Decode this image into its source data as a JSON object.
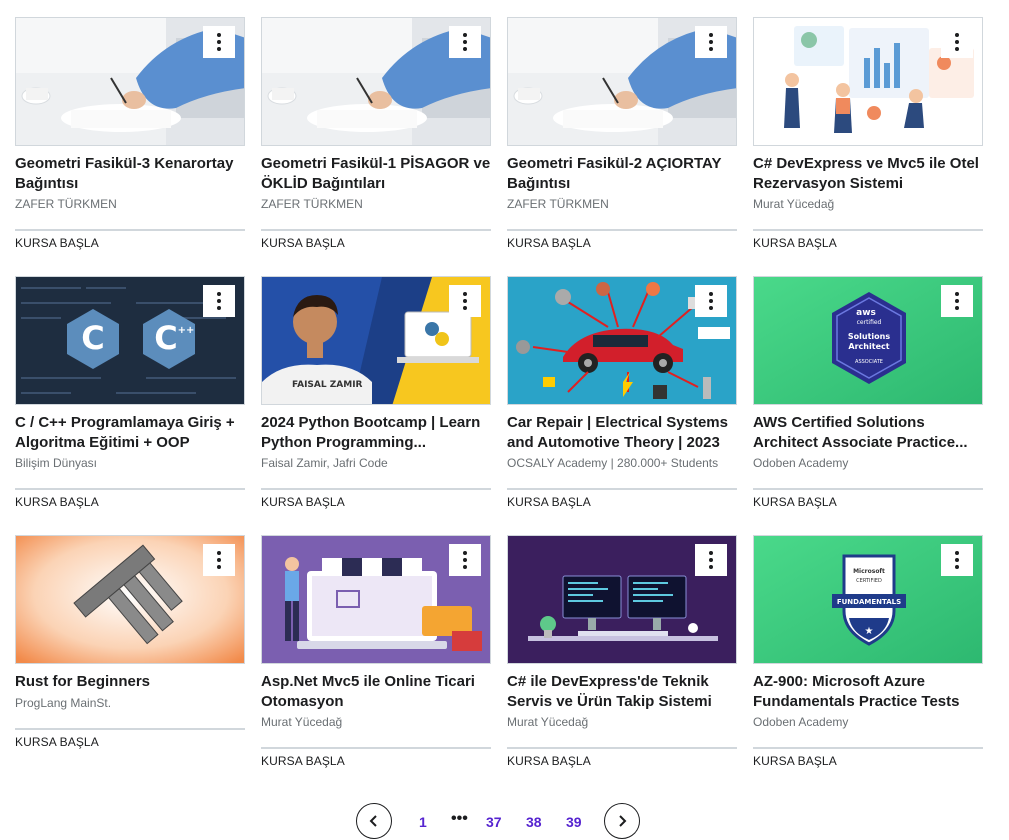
{
  "courses": [
    {
      "title": "Geometri Fasikül-3 Kenarortay Bağıntısı",
      "author": "ZAFER TÜRKMEN",
      "cta": "KURSA BAŞLA",
      "image": "desk-writing-photo"
    },
    {
      "title": "Geometri Fasikül-1 PİSAGOR ve ÖKLİD Bağıntıları",
      "author": "ZAFER TÜRKMEN",
      "cta": "KURSA BAŞLA",
      "image": "desk-writing-photo"
    },
    {
      "title": "Geometri Fasikül-2 AÇIORTAY Bağıntısı",
      "author": "ZAFER TÜRKMEN",
      "cta": "KURSA BAŞLA",
      "image": "desk-writing-photo"
    },
    {
      "title": "C# DevExpress ve Mvc5 ile Otel Rezervasyon Sistemi",
      "author": "Murat Yücedağ",
      "cta": "KURSA BAŞLA",
      "image": "analytics-illustration"
    },
    {
      "title": "C / C++ Programlamaya Giriş + Algoritma Eğitimi + OOP",
      "author": "Bilişim Dünyası",
      "cta": "KURSA BAŞLA",
      "image": "c-cpp-logos"
    },
    {
      "title": "2024 Python Bootcamp | Learn Python Programming...",
      "author": "Faisal Zamir, Jafri Code",
      "cta": "KURSA BAŞLA",
      "image": "python-instructor"
    },
    {
      "title": "Car Repair | Electrical Systems and Automotive Theory | 2023",
      "author": "OCSALY Academy | 280.000+ Students",
      "cta": "KURSA BAŞLA",
      "image": "car-parts-illustration"
    },
    {
      "title": "AWS Certified Solutions Architect Associate Practice...",
      "author": "Odoben Academy",
      "cta": "KURSA BAŞLA",
      "image": "aws-badge"
    },
    {
      "title": "Rust for Beginners",
      "author": "ProgLang MainSt.",
      "cta": "KURSA BAŞLA",
      "image": "rust-hammer"
    },
    {
      "title": "Asp.Net Mvc5 ile Online Ticari Otomasyon",
      "author": "Murat Yücedağ",
      "cta": "KURSA BAŞLA",
      "image": "online-shop-illustration"
    },
    {
      "title": "C# ile DevExpress'de Teknik Servis ve Ürün Takip Sistemi",
      "author": "Murat Yücedağ",
      "cta": "KURSA BAŞLA",
      "image": "developer-desk-illustration"
    },
    {
      "title": "AZ-900: Microsoft Azure Fundamentals Practice Tests",
      "author": "Odoben Academy",
      "cta": "KURSA BAŞLA",
      "image": "azure-badge"
    }
  ],
  "thumb_text": {
    "python_name": "FAISAL ZAMIR",
    "aws_logo": "aws",
    "aws_certified": "certified",
    "aws_l1": "Solutions",
    "aws_l2": "Architect",
    "aws_l3": "ASSOCIATE",
    "ms_l1": "Microsoft",
    "ms_l2": "CERTIFIED",
    "ms_l3": "FUNDAMENTALS"
  },
  "pagination": {
    "prev_icon": "chevron-left-icon",
    "next_icon": "chevron-right-icon",
    "pages": [
      "1",
      "37",
      "38",
      "39"
    ],
    "ellipsis": "•••"
  }
}
